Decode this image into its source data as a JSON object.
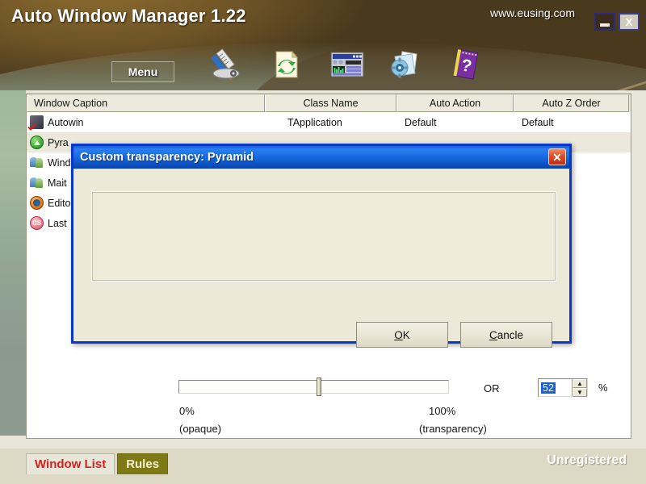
{
  "window": {
    "title": "Auto Window Manager 1.22",
    "site_url": "www.eusing.com",
    "minimize_label": "_",
    "close_label": "X"
  },
  "toolbar": {
    "menu_label": "Menu",
    "icons": [
      {
        "name": "pencil-ruler-icon",
        "title": "Options"
      },
      {
        "name": "document-refresh-icon",
        "title": "Refresh"
      },
      {
        "name": "window-panel-icon",
        "title": "Window"
      },
      {
        "name": "gear-folder-icon",
        "title": "Settings"
      },
      {
        "name": "help-book-icon",
        "title": "Help"
      }
    ]
  },
  "list": {
    "columns": [
      "Window Caption",
      "Class Name",
      "Auto Action",
      "Auto Z Order"
    ],
    "rows": [
      {
        "icon": "ic-autowin",
        "caption": "Autowin",
        "class_name": "TApplication",
        "auto_action": "Default",
        "auto_z_order": "Default",
        "selected": false
      },
      {
        "icon": "ic-green",
        "caption": "Pyra",
        "class_name": "",
        "auto_action": "",
        "auto_z_order": "",
        "selected": true
      },
      {
        "icon": "ic-people",
        "caption": "Wind",
        "class_name": "",
        "auto_action": "",
        "auto_z_order": "",
        "selected": false
      },
      {
        "icon": "ic-people",
        "caption": "Mait",
        "class_name": "",
        "auto_action": "",
        "auto_z_order": "",
        "selected": false
      },
      {
        "icon": "ic-fox",
        "caption": "Edito",
        "class_name": "",
        "auto_action": "",
        "auto_z_order": "",
        "selected": false
      },
      {
        "icon": "ic-pink",
        "caption": "Last",
        "class_name": "",
        "auto_action": "",
        "auto_z_order": "",
        "selected": false
      }
    ]
  },
  "tabs": {
    "window_list": "Window List",
    "rules": "Rules",
    "active": "Rules"
  },
  "status": {
    "registration": "Unregistered"
  },
  "dialog": {
    "title": "Custom transparency: Pyramid",
    "close_label": "✕",
    "slider": {
      "value": 52,
      "min": 0,
      "max": 100,
      "min_label": "0%",
      "min_sublabel": "(opaque)",
      "max_label": "100%",
      "max_sublabel": "(transparency)"
    },
    "or_label": "OR",
    "percent_label": "%",
    "spin_value": "52",
    "spin_up": "▲",
    "spin_down": "▼",
    "ok_label": "OK",
    "cancel_label": "Cancle"
  },
  "colors": {
    "accent_blue": "#0a38c8",
    "title_gradient": "#1668dd",
    "dialog_face": "#ECE9D8",
    "tab_active": "#7D7A14",
    "tab_text_red": "#D42020",
    "selection_blue": "#1E5FD0"
  }
}
